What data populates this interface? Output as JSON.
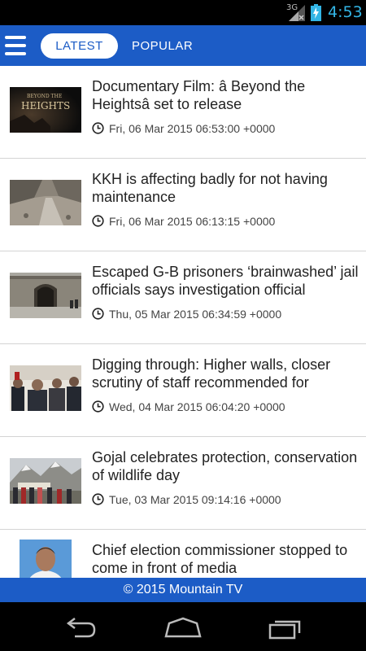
{
  "status_bar": {
    "network": "3G",
    "time": "4:53",
    "accent_color": "#33b5e5"
  },
  "app_bar": {
    "color": "#1c5cc6",
    "tabs": [
      {
        "label": "LATEST",
        "selected": true
      },
      {
        "label": "POPULAR",
        "selected": false
      }
    ]
  },
  "articles": [
    {
      "title": "Documentary Film: â  Beyond the Heightsâ   set to release",
      "date": "Fri, 06 Mar 2015 06:53:00 +0000",
      "thumb_text": "HEIGHTS",
      "thumb_subtext": "BEYOND THE"
    },
    {
      "title": "KKH is affecting badly for not having maintenance",
      "date": "Fri, 06 Mar 2015 06:13:15 +0000"
    },
    {
      "title": "Escaped G-B prisoners ‘brainwashed’ jail officials says investigation official",
      "date": "Thu, 05 Mar 2015 06:34:59 +0000"
    },
    {
      "title": "Digging through: Higher walls, closer scrutiny of staff recommended for",
      "date": "Wed, 04 Mar 2015 06:04:20 +0000"
    },
    {
      "title": "Gojal celebrates protection, conservation of wildlife day",
      "date": "Tue, 03 Mar 2015 09:14:16 +0000"
    },
    {
      "title": "Chief election commissioner stopped to come in front of media",
      "date": ""
    }
  ],
  "footer": {
    "text": "© 2015 Mountain TV"
  },
  "icons": {
    "menu": "hamburger-menu-icon",
    "clock": "clock-icon",
    "back": "back-icon",
    "home": "home-icon",
    "recents": "recents-icon"
  }
}
